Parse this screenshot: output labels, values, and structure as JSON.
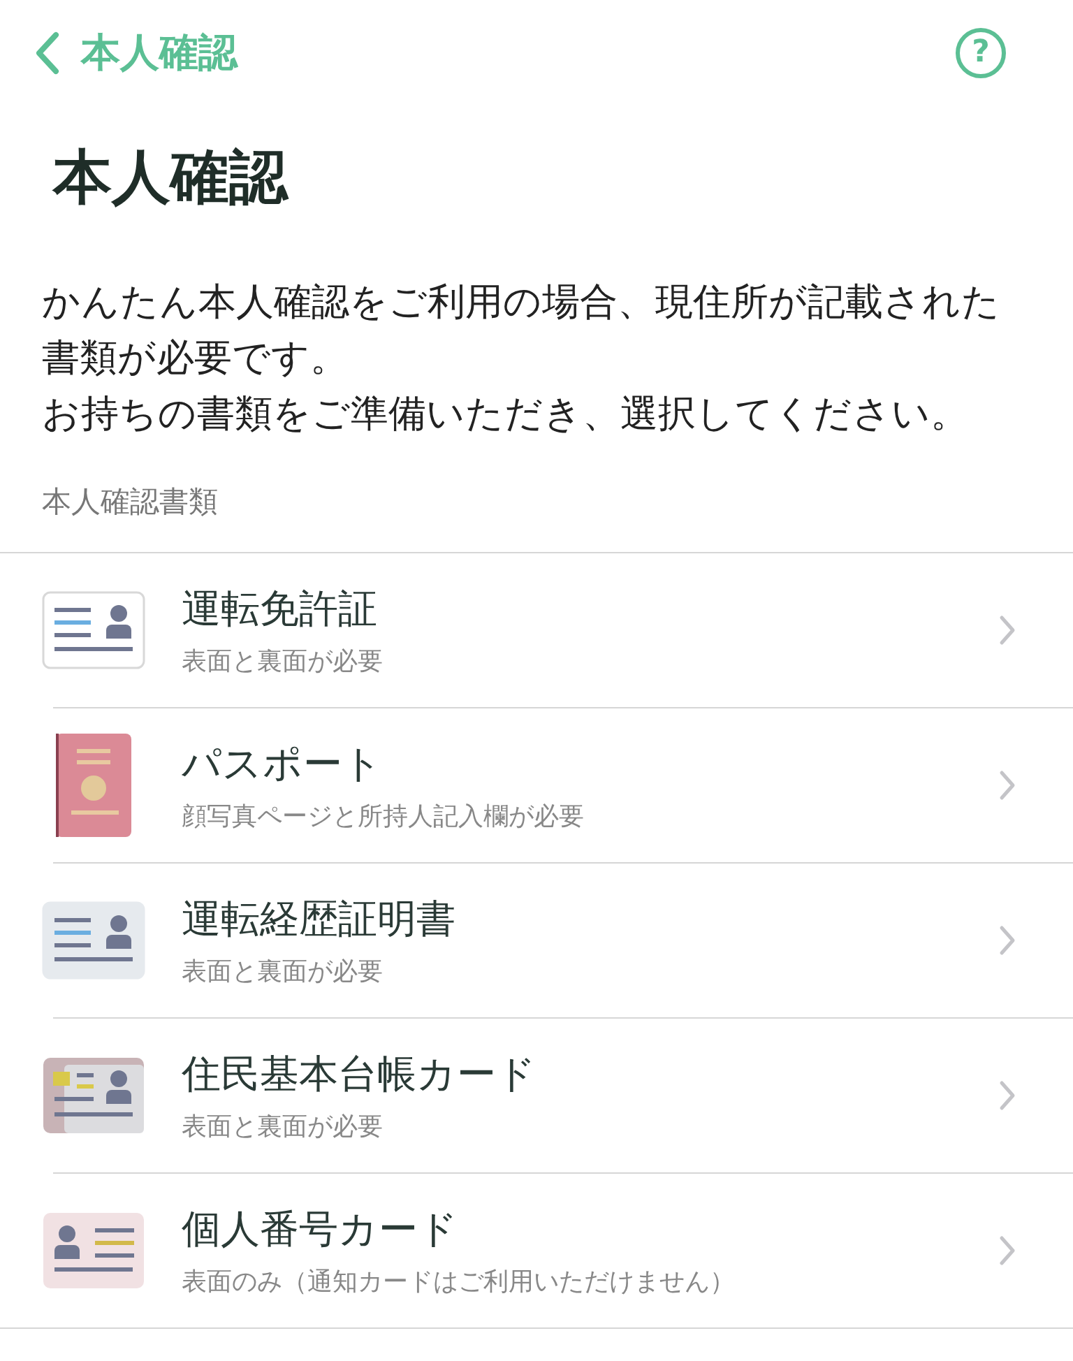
{
  "nav": {
    "back_label": "本人確認",
    "help": "?"
  },
  "title": "本人確認",
  "description": [
    "かんたん本人確認をご利用の場合、現住所が記載された書類が必要です。",
    "お持ちの書類をご準備いただき、選択してください。"
  ],
  "section_label": "本人確認書類",
  "documents": [
    {
      "kind": "license",
      "name": "運転免許証",
      "note": "表面と裏面が必要"
    },
    {
      "kind": "passport",
      "name": "パスポート",
      "note": "顔写真ページと所持人記入欄が必要"
    },
    {
      "kind": "history",
      "name": "運転経歴証明書",
      "note": "表面と裏面が必要"
    },
    {
      "kind": "juki",
      "name": "住民基本台帳カード",
      "note": "表面と裏面が必要"
    },
    {
      "kind": "mynumber",
      "name": "個人番号カード",
      "note": "表面のみ（通知カードはご利用いただけません）"
    }
  ]
}
